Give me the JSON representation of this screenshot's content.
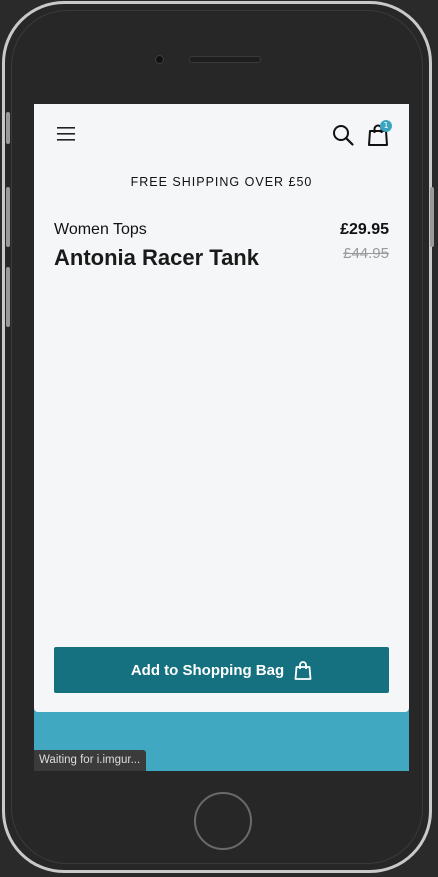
{
  "header": {
    "menu_icon": "hamburger-menu-icon",
    "search_icon": "search-icon",
    "bag_icon": "shopping-bag-icon",
    "bag_count": "1"
  },
  "banner": {
    "text": "FREE SHIPPING OVER £50"
  },
  "product": {
    "category": "Women Tops",
    "title": "Antonia Racer Tank",
    "price_current": "£29.95",
    "price_old": "£44.95"
  },
  "cta": {
    "label": "Add to Shopping Bag",
    "icon": "shopping-bag-icon"
  },
  "status_bar": {
    "text": "Waiting for i.imgur..."
  },
  "colors": {
    "accent": "#15707f",
    "badge": "#3aa5c0",
    "backdrop": "#40a8c1",
    "sheet": "#f4f6f8"
  }
}
